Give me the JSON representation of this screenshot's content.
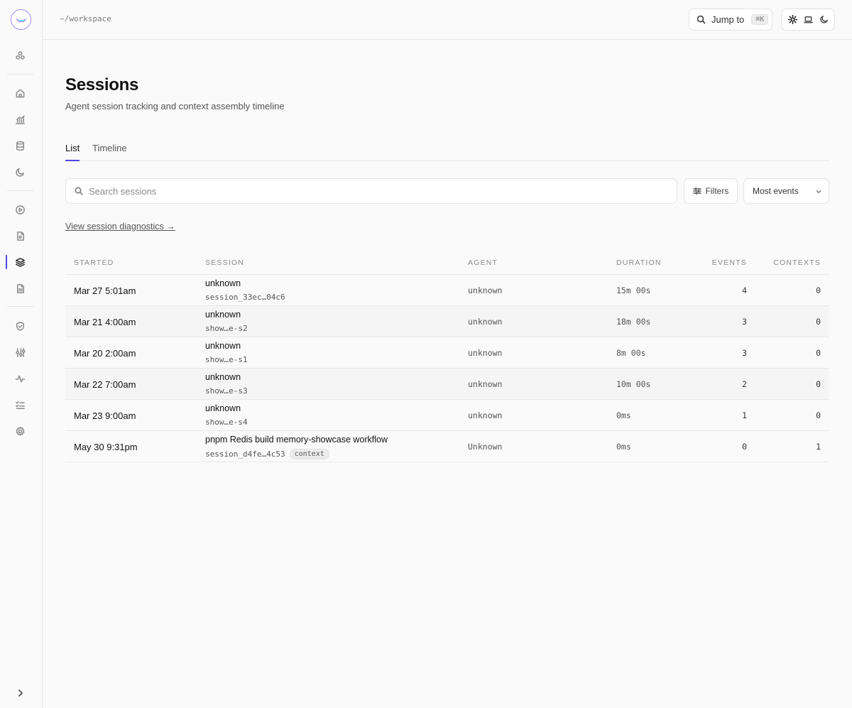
{
  "topbar": {
    "breadcrumb": "~/workspace",
    "jump_label": "Jump to",
    "jump_shortcut": "⌘K"
  },
  "page": {
    "title": "Sessions",
    "subtitle": "Agent session tracking and context assembly timeline"
  },
  "tabs": [
    {
      "label": "List",
      "active": true
    },
    {
      "label": "Timeline",
      "active": false
    }
  ],
  "toolbar": {
    "search_placeholder": "Search sessions",
    "filters_label": "Filters",
    "sort_value": "Most events"
  },
  "diagnostics_link": "View session diagnostics →",
  "table": {
    "headers": {
      "started": "STARTED",
      "session": "SESSION",
      "agent": "AGENT",
      "duration": "DURATION",
      "events": "EVENTS",
      "contexts": "CONTEXTS"
    },
    "rows": [
      {
        "started": "Mar 27 5:01am",
        "name": "unknown",
        "id": "session_33ec…04c6",
        "badge": "",
        "agent": "unknown",
        "duration": "15m 00s",
        "events": "4",
        "contexts": "0"
      },
      {
        "started": "Mar 21 4:00am",
        "name": "unknown",
        "id": "show…e-s2",
        "badge": "",
        "agent": "unknown",
        "duration": "18m 00s",
        "events": "3",
        "contexts": "0"
      },
      {
        "started": "Mar 20 2:00am",
        "name": "unknown",
        "id": "show…e-s1",
        "badge": "",
        "agent": "unknown",
        "duration": "8m 00s",
        "events": "3",
        "contexts": "0"
      },
      {
        "started": "Mar 22 7:00am",
        "name": "unknown",
        "id": "show…e-s3",
        "badge": "",
        "agent": "unknown",
        "duration": "10m 00s",
        "events": "2",
        "contexts": "0"
      },
      {
        "started": "Mar 23 9:00am",
        "name": "unknown",
        "id": "show…e-s4",
        "badge": "",
        "agent": "unknown",
        "duration": "0ms",
        "events": "1",
        "contexts": "0"
      },
      {
        "started": "May 30 9:31pm",
        "name": "pnpm Redis build memory-showcase workflow",
        "id": "session_d4fe…4c53",
        "badge": "context",
        "agent": "Unknown",
        "duration": "0ms",
        "events": "0",
        "contexts": "1"
      }
    ]
  },
  "colors": {
    "accent": "#4f46e5"
  }
}
